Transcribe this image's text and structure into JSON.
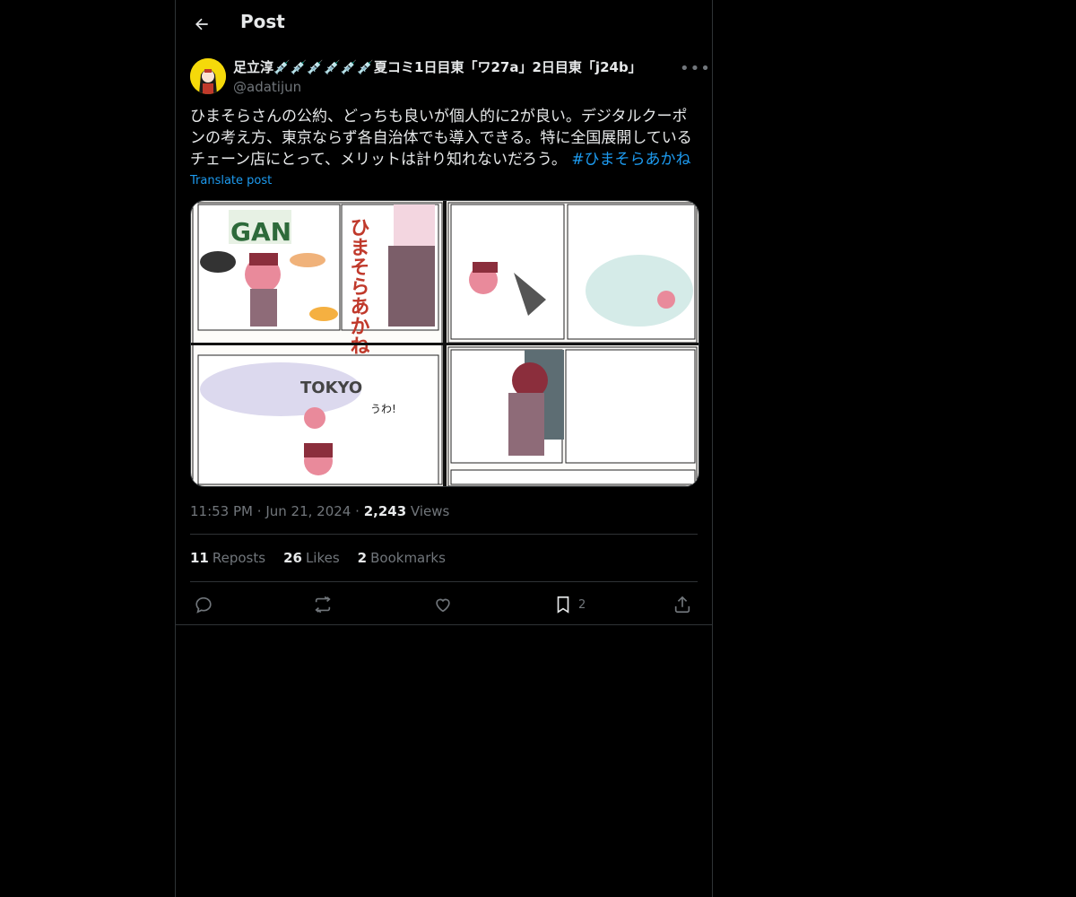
{
  "header": {
    "title": "Post"
  },
  "post": {
    "display_name": "足立淳💉💉💉💉💉💉夏コミ1日目東「ワ27a」2日目東「j24b」",
    "handle": "@adatijun",
    "text": "ひまそらさんの公約、どっちも良いが個人的に2が良い。デジタルクーポンの考え方、東京ならず各自治体でも導入できる。特に全国展開しているチェーン店にとって、メリットは計り知れないだろう。",
    "hashtag": "#ひまそらあかね",
    "translate": "Translate post",
    "time": "11:53 PM",
    "date": "Jun 21, 2024",
    "views_count": "2,243",
    "views_label": "Views",
    "dot": "·"
  },
  "stats": {
    "reposts_count": "11",
    "reposts_label": "Reposts",
    "likes_count": "26",
    "likes_label": "Likes",
    "bookmarks_count": "2",
    "bookmarks_label": "Bookmarks"
  },
  "actions": {
    "bookmark_count": "2"
  },
  "media": {
    "manga_texts": [
      "GAN",
      "ひまそらあかね",
      "TOKYO",
      "うわ!"
    ]
  },
  "icons": {
    "back": "arrow-left-icon",
    "more": "more-horizontal-icon",
    "reply": "reply-icon",
    "repost": "repost-icon",
    "like": "heart-icon",
    "bookmark": "bookmark-icon",
    "share": "share-icon"
  },
  "colors": {
    "background": "#000000",
    "text": "#e7e9ea",
    "muted": "#71767b",
    "accent": "#1d9bf0",
    "border": "#2f3336"
  }
}
